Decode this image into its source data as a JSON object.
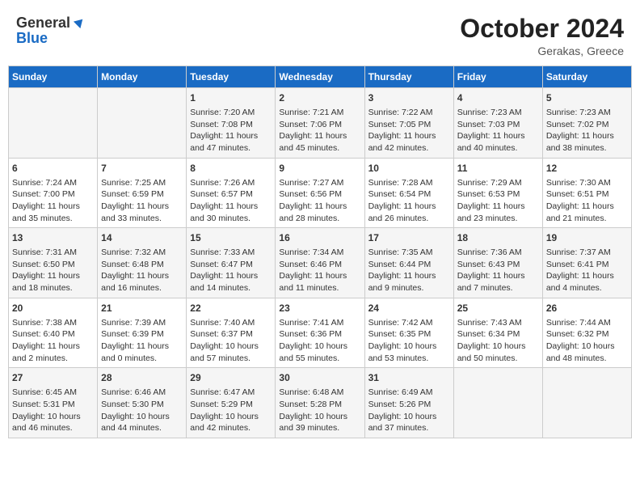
{
  "header": {
    "logo_general": "General",
    "logo_blue": "Blue",
    "month_title": "October 2024",
    "location": "Gerakas, Greece"
  },
  "weekdays": [
    "Sunday",
    "Monday",
    "Tuesday",
    "Wednesday",
    "Thursday",
    "Friday",
    "Saturday"
  ],
  "weeks": [
    [
      {
        "day": "",
        "info": ""
      },
      {
        "day": "",
        "info": ""
      },
      {
        "day": "1",
        "info": "Sunrise: 7:20 AM\nSunset: 7:08 PM\nDaylight: 11 hours and 47 minutes."
      },
      {
        "day": "2",
        "info": "Sunrise: 7:21 AM\nSunset: 7:06 PM\nDaylight: 11 hours and 45 minutes."
      },
      {
        "day": "3",
        "info": "Sunrise: 7:22 AM\nSunset: 7:05 PM\nDaylight: 11 hours and 42 minutes."
      },
      {
        "day": "4",
        "info": "Sunrise: 7:23 AM\nSunset: 7:03 PM\nDaylight: 11 hours and 40 minutes."
      },
      {
        "day": "5",
        "info": "Sunrise: 7:23 AM\nSunset: 7:02 PM\nDaylight: 11 hours and 38 minutes."
      }
    ],
    [
      {
        "day": "6",
        "info": "Sunrise: 7:24 AM\nSunset: 7:00 PM\nDaylight: 11 hours and 35 minutes."
      },
      {
        "day": "7",
        "info": "Sunrise: 7:25 AM\nSunset: 6:59 PM\nDaylight: 11 hours and 33 minutes."
      },
      {
        "day": "8",
        "info": "Sunrise: 7:26 AM\nSunset: 6:57 PM\nDaylight: 11 hours and 30 minutes."
      },
      {
        "day": "9",
        "info": "Sunrise: 7:27 AM\nSunset: 6:56 PM\nDaylight: 11 hours and 28 minutes."
      },
      {
        "day": "10",
        "info": "Sunrise: 7:28 AM\nSunset: 6:54 PM\nDaylight: 11 hours and 26 minutes."
      },
      {
        "day": "11",
        "info": "Sunrise: 7:29 AM\nSunset: 6:53 PM\nDaylight: 11 hours and 23 minutes."
      },
      {
        "day": "12",
        "info": "Sunrise: 7:30 AM\nSunset: 6:51 PM\nDaylight: 11 hours and 21 minutes."
      }
    ],
    [
      {
        "day": "13",
        "info": "Sunrise: 7:31 AM\nSunset: 6:50 PM\nDaylight: 11 hours and 18 minutes."
      },
      {
        "day": "14",
        "info": "Sunrise: 7:32 AM\nSunset: 6:48 PM\nDaylight: 11 hours and 16 minutes."
      },
      {
        "day": "15",
        "info": "Sunrise: 7:33 AM\nSunset: 6:47 PM\nDaylight: 11 hours and 14 minutes."
      },
      {
        "day": "16",
        "info": "Sunrise: 7:34 AM\nSunset: 6:46 PM\nDaylight: 11 hours and 11 minutes."
      },
      {
        "day": "17",
        "info": "Sunrise: 7:35 AM\nSunset: 6:44 PM\nDaylight: 11 hours and 9 minutes."
      },
      {
        "day": "18",
        "info": "Sunrise: 7:36 AM\nSunset: 6:43 PM\nDaylight: 11 hours and 7 minutes."
      },
      {
        "day": "19",
        "info": "Sunrise: 7:37 AM\nSunset: 6:41 PM\nDaylight: 11 hours and 4 minutes."
      }
    ],
    [
      {
        "day": "20",
        "info": "Sunrise: 7:38 AM\nSunset: 6:40 PM\nDaylight: 11 hours and 2 minutes."
      },
      {
        "day": "21",
        "info": "Sunrise: 7:39 AM\nSunset: 6:39 PM\nDaylight: 11 hours and 0 minutes."
      },
      {
        "day": "22",
        "info": "Sunrise: 7:40 AM\nSunset: 6:37 PM\nDaylight: 10 hours and 57 minutes."
      },
      {
        "day": "23",
        "info": "Sunrise: 7:41 AM\nSunset: 6:36 PM\nDaylight: 10 hours and 55 minutes."
      },
      {
        "day": "24",
        "info": "Sunrise: 7:42 AM\nSunset: 6:35 PM\nDaylight: 10 hours and 53 minutes."
      },
      {
        "day": "25",
        "info": "Sunrise: 7:43 AM\nSunset: 6:34 PM\nDaylight: 10 hours and 50 minutes."
      },
      {
        "day": "26",
        "info": "Sunrise: 7:44 AM\nSunset: 6:32 PM\nDaylight: 10 hours and 48 minutes."
      }
    ],
    [
      {
        "day": "27",
        "info": "Sunrise: 6:45 AM\nSunset: 5:31 PM\nDaylight: 10 hours and 46 minutes."
      },
      {
        "day": "28",
        "info": "Sunrise: 6:46 AM\nSunset: 5:30 PM\nDaylight: 10 hours and 44 minutes."
      },
      {
        "day": "29",
        "info": "Sunrise: 6:47 AM\nSunset: 5:29 PM\nDaylight: 10 hours and 42 minutes."
      },
      {
        "day": "30",
        "info": "Sunrise: 6:48 AM\nSunset: 5:28 PM\nDaylight: 10 hours and 39 minutes."
      },
      {
        "day": "31",
        "info": "Sunrise: 6:49 AM\nSunset: 5:26 PM\nDaylight: 10 hours and 37 minutes."
      },
      {
        "day": "",
        "info": ""
      },
      {
        "day": "",
        "info": ""
      }
    ]
  ]
}
